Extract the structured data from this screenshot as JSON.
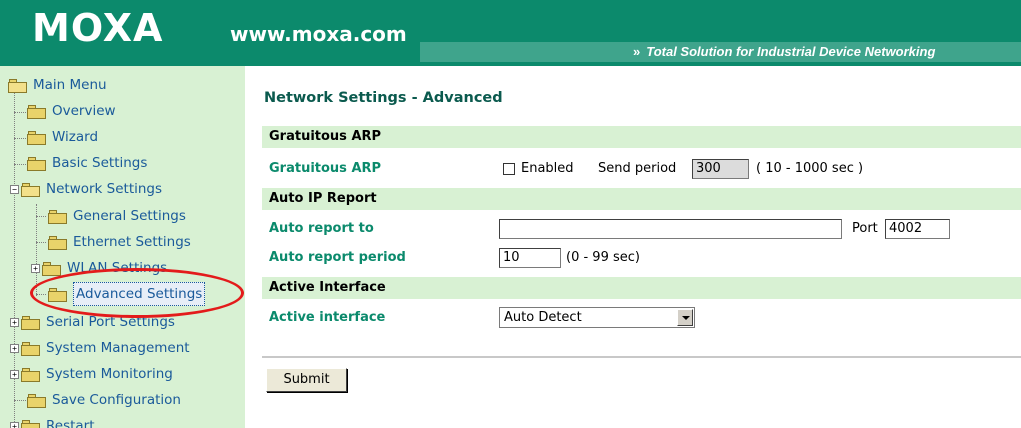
{
  "header": {
    "logo": "MOXA",
    "site_url": "www.moxa.com",
    "tagline_arrows": "»",
    "tagline": "Total Solution for Industrial Device Networking"
  },
  "sidebar": {
    "root_label": "Main Menu",
    "items": [
      {
        "label": "Overview"
      },
      {
        "label": "Wizard"
      },
      {
        "label": "Basic Settings"
      },
      {
        "label": "Network Settings",
        "expander": "−"
      },
      {
        "label": "General Settings"
      },
      {
        "label": "Ethernet Settings"
      },
      {
        "label": "WLAN Settings",
        "expander": "+"
      },
      {
        "label": "Advanced Settings",
        "selected": true
      },
      {
        "label": "Serial Port Settings",
        "expander": "+"
      },
      {
        "label": "System Management",
        "expander": "+"
      },
      {
        "label": "System Monitoring",
        "expander": "+"
      },
      {
        "label": "Save Configuration"
      },
      {
        "label": "Restart",
        "expander": "+"
      }
    ]
  },
  "main": {
    "page_title": "Network Settings - Advanced",
    "gratuitous_arp": {
      "section_title": "Gratuitous ARP",
      "label": "Gratuitous ARP",
      "enabled_label": "Enabled",
      "enabled_checked": false,
      "send_period_label": "Send period",
      "send_period_value": "300",
      "send_period_range": "( 10 - 1000 sec )"
    },
    "auto_ip_report": {
      "section_title": "Auto IP Report",
      "report_to_label": "Auto report to",
      "report_to_value": "",
      "port_label": "Port",
      "port_value": "4002",
      "report_period_label": "Auto report period",
      "report_period_value": "10",
      "report_period_range": "(0 - 99 sec)"
    },
    "active_interface": {
      "section_title": "Active Interface",
      "label": "Active interface",
      "selected_value": "Auto Detect"
    },
    "submit_label": "Submit"
  },
  "colors": {
    "header_bg": "#0c8a6c",
    "sidebar_bg": "#d8f1d3",
    "field_label": "#0b8a6c",
    "title": "#0b5a4e",
    "annotation_circle": "#e31b1b"
  }
}
